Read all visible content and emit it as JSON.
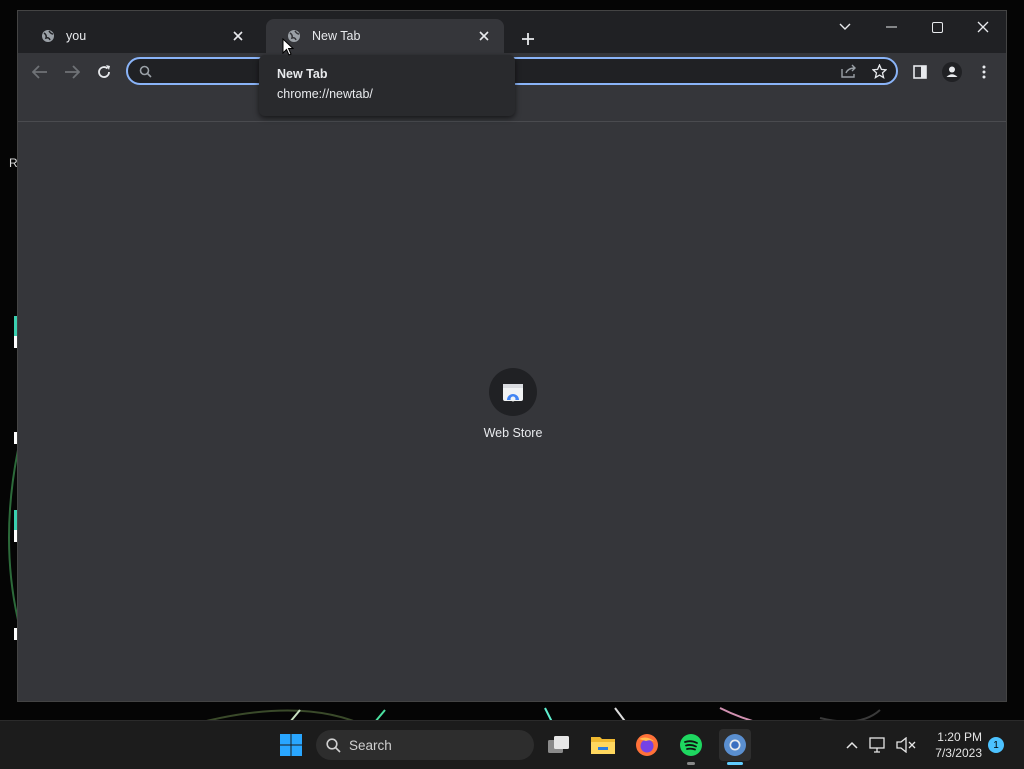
{
  "browser": {
    "tabs": [
      {
        "title": "you",
        "favicon": "globe-icon",
        "active": false
      },
      {
        "title": "New Tab",
        "favicon": "globe-icon",
        "active": true
      }
    ],
    "omnibox": {
      "value": "",
      "placeholder": ""
    },
    "tooltip": {
      "title": "New Tab",
      "url": "chrome://newtab/"
    },
    "shortcuts": [
      {
        "label": "Web Store",
        "icon": "web-store-icon"
      }
    ],
    "accent": "#8ab4f8"
  },
  "desktop": {
    "edge_label": "Re"
  },
  "taskbar": {
    "search_label": "Search",
    "time": "1:20 PM",
    "date": "7/3/2023",
    "notification_count": "1",
    "pinned": [
      "start-icon",
      "task-view-icon",
      "file-explorer-icon",
      "firefox-icon",
      "spotify-icon",
      "chrome-icon"
    ]
  }
}
